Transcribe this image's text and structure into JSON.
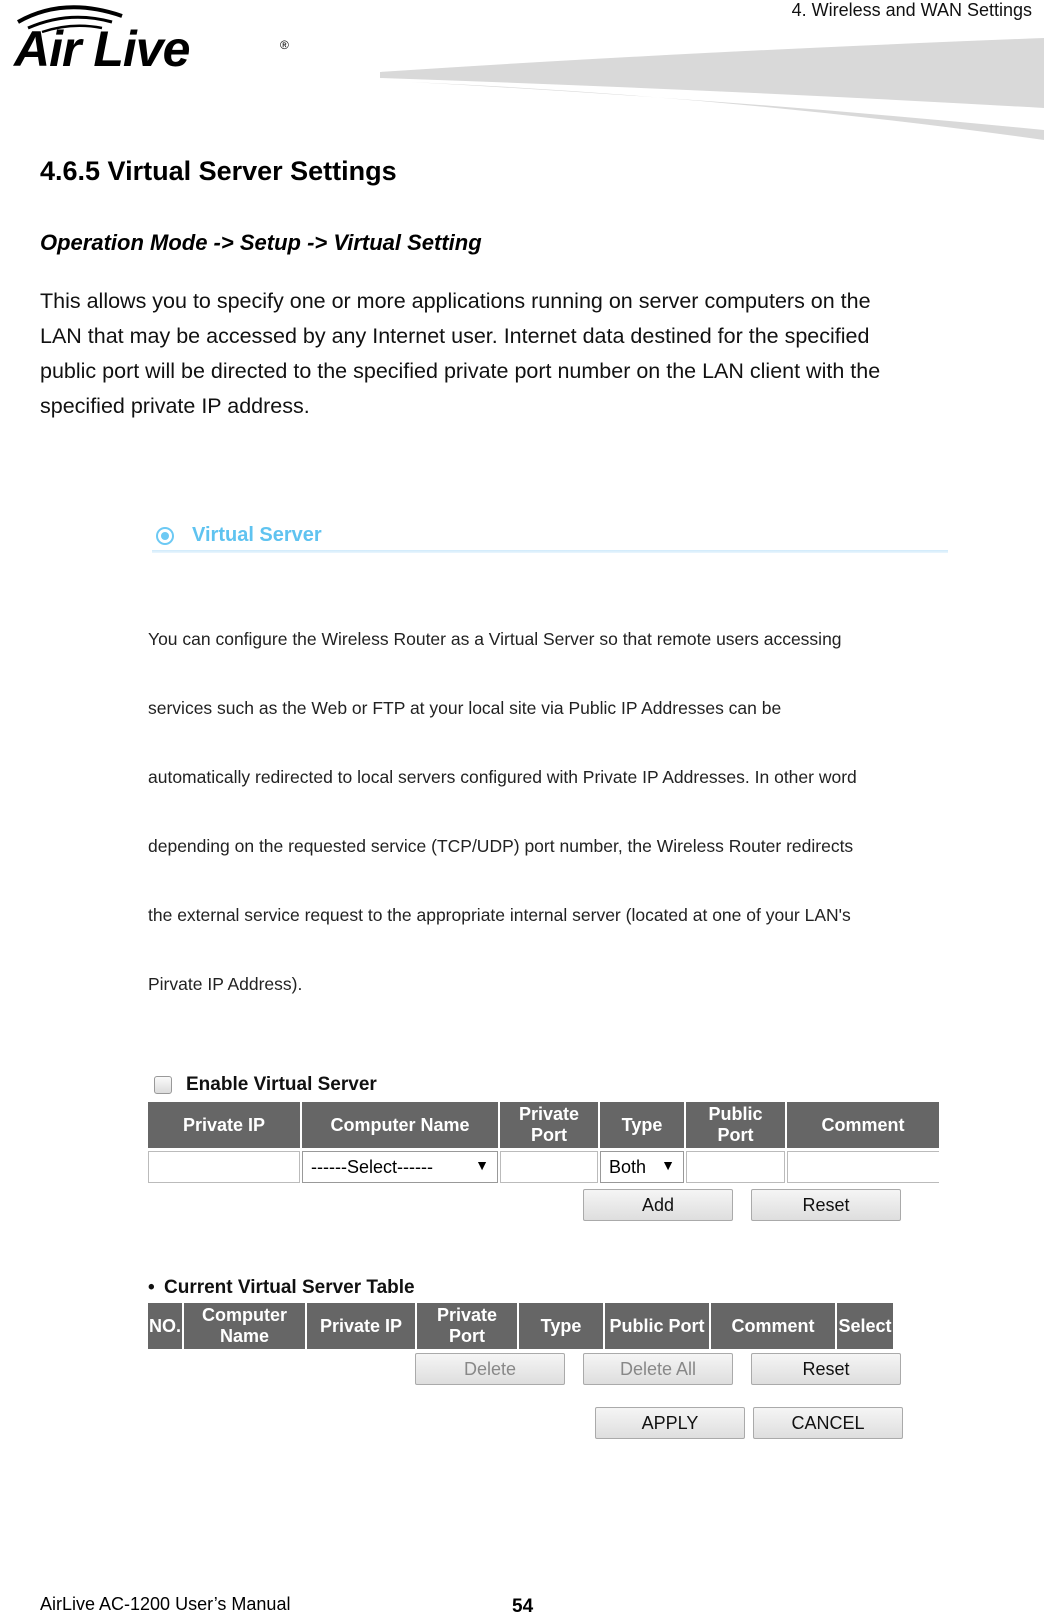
{
  "header": {
    "chapter": "4. Wireless and WAN Settings",
    "logo_text": "Air Live",
    "logo_mark": "®"
  },
  "section": {
    "title": "4.6.5 Virtual Server Settings",
    "breadcrumb": "Operation Mode -> Setup -> Virtual Setting",
    "intro_lines": [
      "This allows you to specify one or more applications running on server computers on the",
      "LAN that may be accessed by any Internet user. Internet data destined for the specified",
      "public port will be directed to the specified private port number on the LAN client with the",
      "specified private IP address."
    ]
  },
  "screenshot": {
    "panel_title": "Virtual Server",
    "panel_icon": "target-icon",
    "description_lines": [
      "You can configure the Wireless Router as a Virtual Server so that remote users accessing",
      "services such as the Web or FTP at your local site via Public IP Addresses can be",
      "automatically redirected to local servers configured with Private IP Addresses. In other word",
      "depending on the requested service (TCP/UDP) port number, the Wireless Router redirects",
      "the external service request to the appropriate internal server (located at one of your LAN's",
      "Pirvate IP Address)."
    ],
    "enable_checkbox": {
      "label": "Enable Virtual Server",
      "checked": false
    },
    "entry_table": {
      "headers": [
        "Private IP",
        "Computer Name",
        "Private Port",
        "Type",
        "Public Port",
        "Comment"
      ],
      "row": {
        "private_ip": "",
        "computer_name": "------Select------",
        "private_port": "",
        "type": "Both",
        "public_port": "",
        "comment": ""
      }
    },
    "entry_buttons": {
      "add": "Add",
      "reset": "Reset"
    },
    "current_table": {
      "title": "Current Virtual Server Table",
      "bullet": "•",
      "headers": [
        "NO.",
        "Computer Name",
        "Private IP",
        "Private Port",
        "Type",
        "Public Port",
        "Comment",
        "Select"
      ],
      "rows": []
    },
    "table_buttons": {
      "delete": "Delete",
      "delete_all": "Delete All",
      "reset": "Reset"
    },
    "footer_buttons": {
      "apply": "APPLY",
      "cancel": "CANCEL"
    }
  },
  "footer": {
    "manual": "AirLive AC-1200 User’s Manual",
    "page": "54"
  }
}
